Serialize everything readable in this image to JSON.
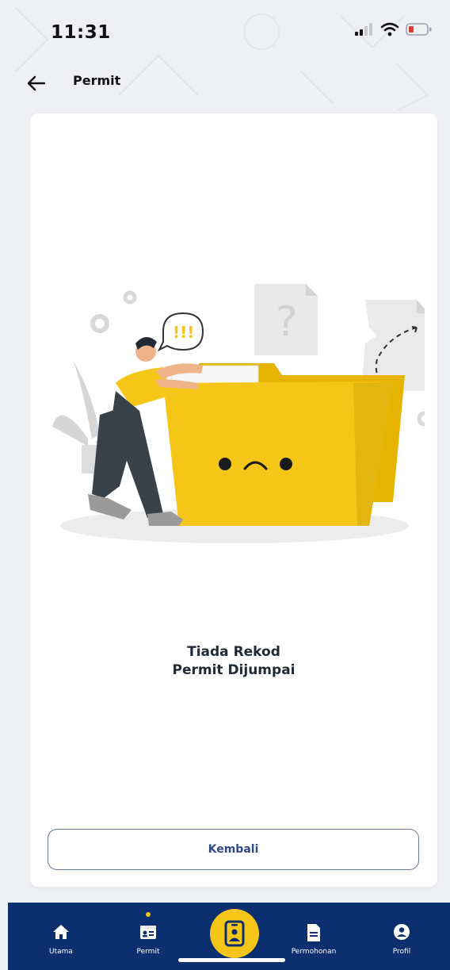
{
  "status_bar": {
    "time": "11:31",
    "icons": [
      "signal-icon",
      "wifi-icon",
      "battery-low-icon"
    ]
  },
  "header": {
    "back_icon": "arrow-left-icon",
    "title": "Permit"
  },
  "empty_state": {
    "illustration": "person-sad-folder-illustration",
    "exclamation": "!!!",
    "question_mark": "?",
    "title_line1": "Tiada Rekod",
    "title_line2": "Permit Dijumpai"
  },
  "actions": {
    "back_label": "Kembali"
  },
  "bottom_nav": {
    "items": [
      {
        "label": "Utama",
        "icon": "home-icon",
        "active": false
      },
      {
        "label": "Permit",
        "icon": "id-card-icon",
        "active": true
      },
      {
        "label": "",
        "icon": "badge-icon",
        "active": false
      },
      {
        "label": "Permohonan",
        "icon": "document-icon",
        "active": false
      },
      {
        "label": "Profil",
        "icon": "user-circle-icon",
        "active": false
      }
    ]
  },
  "colors": {
    "nav_background": "#0c2f6f",
    "accent_yellow": "#f5c518",
    "button_text": "#2f4a8a",
    "battery_low": "#e53935"
  }
}
